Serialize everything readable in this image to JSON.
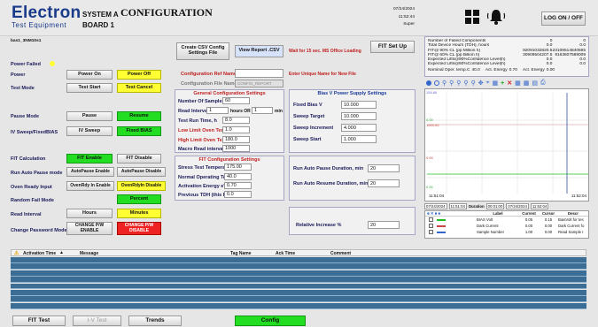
{
  "header": {
    "logo_main": "Electron",
    "logo_sub": "Test Equipment",
    "system_line1": "SYSTEM A",
    "system_line2": "BOARD 1",
    "page_title": "CONFIGURATION",
    "date": "07/24/2024",
    "time": "11:52:44",
    "user_role": "Super",
    "logon_label": "LOG ON / OFF"
  },
  "file_name": "bas1_3NM10s1",
  "left_panel": {
    "power_failed_label": "Power Failed",
    "power_label": "Power",
    "power_on": "Power On",
    "power_off": "Power Off",
    "test_mode_label": "Test Mode",
    "test_start": "Test Start",
    "test_cancel": "Test Cancel",
    "pause_mode_label": "Pause Mode",
    "pause": "Pause",
    "resume": "Resume",
    "iv_label": "IV Sweep/FixedBIAS",
    "iv_sweep": "IV Sweep",
    "fixed_bias": "Fixed BIAS",
    "fit_calc_label": "FIT Calculation",
    "fit_enable": "FIT Enable",
    "fit_disable": "FIT Disable",
    "auto_pause_label": "Run Auto Pause mode",
    "auto_pause_enable": "AutoPause Enable",
    "auto_pause_disable": "AutoPause Disable",
    "oven_ready_label": "Oven Ready Input",
    "oven_enable": "OvenRdy In Enable",
    "oven_disable": "OvenRdyIn Disable",
    "random_fail_label": "Random Fail Mode",
    "percent": "Percent",
    "read_interval_label": "Read Interval",
    "hours": "Hours",
    "minutes": "Minutes",
    "change_pw_label": "Change Password Mode",
    "change_pw_enable": "CHANGE P/W ENABLE",
    "change_pw_disable": "CHANGE P/W DISABLE"
  },
  "config_top": {
    "create_csv": "Create CSV Config Settings File",
    "view_report": "View Report .CSV",
    "wait_msg": "Wait for 15 sec. MS Office Loading",
    "fit_setup": "FIT Set Up",
    "ref_name_label": "Configuration Ref Name",
    "ref_name_hint": "Enter Unique Name for New File",
    "file_name_label": "Configuration File Name",
    "file_name_value": "CONFIG_REPORT"
  },
  "general_settings": {
    "title": "General Configuration Settings",
    "num_samples_label": "Number Of Samples",
    "num_samples": "60",
    "read_interval_label": "Read Interval",
    "read_interval_hours": "1",
    "hours_or": "hours OR",
    "read_interval_min": "1",
    "min": "min",
    "test_run_time_label": "Test Run Time, h",
    "test_run_time": "8.0",
    "low_limit_label": "Low Limit Oven Temperature",
    "low_limit": "1.0",
    "high_limit_label": "High Limit Oven Temp Alarm",
    "high_limit": "180.0",
    "macro_read_label": "Macro Read interval, hours",
    "macro_read": "1000"
  },
  "bias_settings": {
    "title": "Bias V Power Supply Settings",
    "fixed_bias_label": "Fixed Bias V",
    "fixed_bias": "10.000",
    "sweep_target_label": "Sweep Target",
    "sweep_target": "10.000",
    "sweep_increment_label": "Sweep Increment",
    "sweep_increment": "4.000",
    "sweep_start_label": "Sweep Start",
    "sweep_start": "1.000"
  },
  "fit_settings": {
    "title": "FIT Configuration Settings",
    "stress_temp_label": "Stress Test Temperature",
    "stress_temp": "175.00",
    "normal_temp_label": "Normal Operating Temperature",
    "normal_temp": "40.0",
    "activation_label": "Activation Energy eV",
    "activation": "0.70",
    "prev_tdh_label": "Previous TDH (this Device)",
    "prev_tdh": "0.0"
  },
  "auto_pause_settings": {
    "pause_duration_label": "Run Auto Pause Duration, min",
    "pause_duration": "20",
    "resume_duration_label": "Run Auto Resume Duration, min",
    "resume_duration": "20"
  },
  "relative_increase": {
    "label": "Relative Increase %",
    "value": "20"
  },
  "stats": {
    "rows": [
      {
        "label": "Number of Failed Components",
        "v1": "0",
        "v2": "0"
      },
      {
        "label": "Total Device Hours (TDH), hours",
        "v1": "0.0",
        "v2": "0.0"
      },
      {
        "label": "FIT@ 90% CL (pp Million h)",
        "v1": "92091032820.5",
        "v2": "23109514840665"
      },
      {
        "label": "FIT@ 60% CL (pp Billion h)",
        "v1": "30909504207.5",
        "v2": "9163607589009"
      },
      {
        "label": "Expected Lifts@90%Confidence Level(h)",
        "v1": "0.0",
        "v2": "0.0"
      },
      {
        "label": "Expected Lifts@60%Confidence Level(h)",
        "v1": "0.0",
        "v2": "0.0"
      }
    ],
    "footer_label": "Nominal Oper. temp.C",
    "footer_temp": "40.0",
    "footer_act_label": "Act. Energy",
    "footer_act": "0.70",
    "footer_accel_label": "Act. Energy",
    "footer_accel": "0.00"
  },
  "graph": {
    "y_top": "158.88",
    "y_mid1": "0.00",
    "y_mid2": "1000.00",
    "y_low": "0.00",
    "y_bottom": "0.00",
    "time_start": "11:51:04",
    "time_end": "11:52:04",
    "nav_start_date": "07/24/2024",
    "nav_start_time": "11:51:04",
    "duration_label": "Duration",
    "duration": "00:01:00",
    "nav_end_date": "07/24/2024",
    "nav_end_time": "11:52:04"
  },
  "legend_table": {
    "headers": [
      "Label",
      "Current",
      "Cursor",
      "Descr"
    ],
    "rows": [
      {
        "label": "BIAS Volt",
        "current": "0.05",
        "cursor": "0.15",
        "descr": "BiasVolt for tes"
      },
      {
        "label": "Dark Current",
        "current": "0.00",
        "cursor": "0.00",
        "descr": "Dark Current fo"
      },
      {
        "label": "Sample Number",
        "current": "1.00",
        "cursor": "0.00",
        "descr": "Read Sample I"
      }
    ]
  },
  "alarm_table": {
    "headers": [
      "Activation Time",
      "Message",
      "Tag Name",
      "Ack Time",
      "Comment"
    ]
  },
  "bottom_nav": {
    "fit_test": "FIT Test",
    "iv_test": "I-V Test",
    "trends": "Trends",
    "config": "Config"
  },
  "colors": {
    "yellow": "#ffff33",
    "green": "#22dd22",
    "red": "#ee2222",
    "alarm_grid": "#3c6d94",
    "logo_blue": "#1a3a8a"
  }
}
